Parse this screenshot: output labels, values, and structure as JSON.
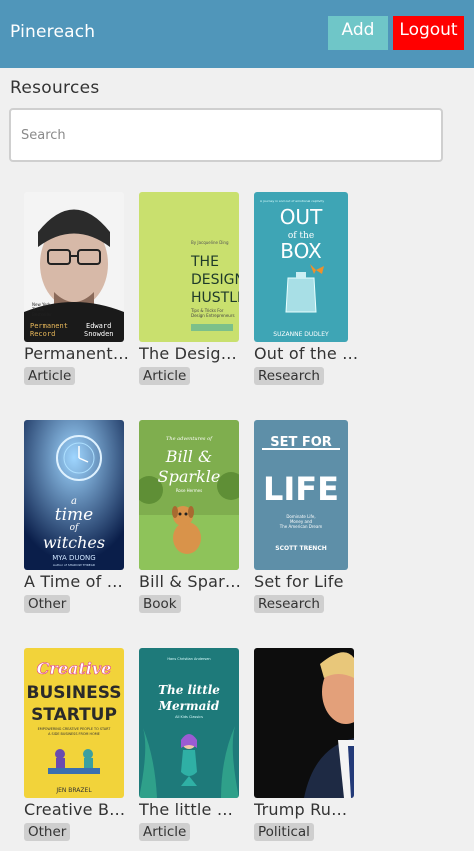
{
  "header": {
    "brand": "Pinereach",
    "add_label": "Add",
    "logout_label": "Logout"
  },
  "section_title": "Resources",
  "search": {
    "placeholder": "Search",
    "value": ""
  },
  "resources": [
    {
      "title": "Permanent Record",
      "tag": "Article",
      "cover_lines": [
        "New York",
        "Times",
        "Bestseller",
        "Permanent",
        "Record",
        "Edward",
        "Snowden"
      ]
    },
    {
      "title": "The Design Hustle",
      "tag": "Article",
      "cover_lines": [
        "By Jacqueline Ding",
        "THE",
        "DESIGN",
        "HUSTLE",
        "Tips & Tricks For",
        "Design Entrepreneurs"
      ]
    },
    {
      "title": "Out of the Box",
      "tag": "Research",
      "cover_lines": [
        "A journey in and out of emotional captivity",
        "OUT",
        "of the",
        "BOX",
        "SUZANNE DUDLEY"
      ]
    },
    {
      "title": "A Time of Witches",
      "tag": "Other",
      "cover_lines": [
        "a",
        "time",
        "of",
        "witches",
        "MYA DUONG",
        "Author of SHADOW THREAD"
      ]
    },
    {
      "title": "Bill & Sparkle",
      "tag": "Book",
      "cover_lines": [
        "The adventures of",
        "Bill &",
        "Sparkle",
        "Rose Hermes"
      ]
    },
    {
      "title": "Set for Life",
      "tag": "Research",
      "cover_lines": [
        "SET FOR",
        "LIFE",
        "Dominate Life,",
        "Money and",
        "The American Dream",
        "SCOTT TRENCH"
      ]
    },
    {
      "title": "Creative Business Startup",
      "tag": "Other",
      "cover_lines": [
        "Creative",
        "BUSINESS",
        "STARTUP",
        "EMPOWERING CREATIVE PEOPLE TO START",
        "A SIDE BUSINESS FROM HOME",
        "JEN BRAZEL"
      ]
    },
    {
      "title": "The little Mermaid",
      "tag": "Article",
      "cover_lines": [
        "Hans Christian Andersen",
        "The little",
        "Mermaid",
        "All Kids Classics"
      ]
    },
    {
      "title": "Trump Rumors",
      "tag": "Political",
      "cover_lines": []
    }
  ]
}
